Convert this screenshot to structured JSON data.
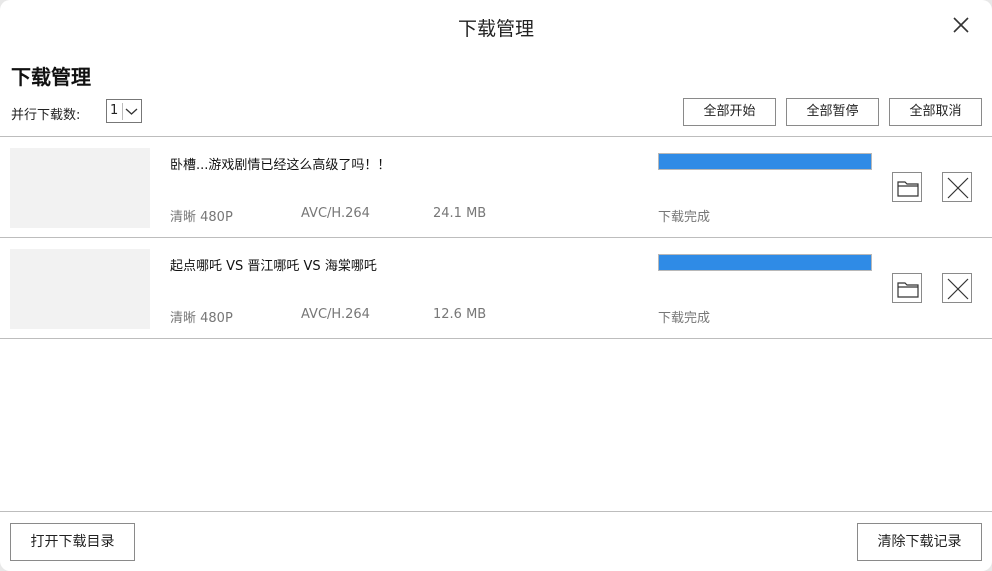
{
  "window": {
    "title": "下载管理"
  },
  "heading": "下载管理",
  "toolbar": {
    "parallel_label": "并行下载数:",
    "parallel_value": "1",
    "start_all": "全部开始",
    "pause_all": "全部暂停",
    "cancel_all": "全部取消"
  },
  "downloads": [
    {
      "title": "卧槽...游戏剧情已经这么高级了吗！！",
      "quality": "清晰 480P",
      "codec": "AVC/H.264",
      "size": "24.1 MB",
      "progress": 1.0,
      "status": "下载完成"
    },
    {
      "title": "起点哪吒 VS 晋江哪吒 VS 海棠哪吒",
      "quality": "清晰 480P",
      "codec": "AVC/H.264",
      "size": "12.6 MB",
      "progress": 1.0,
      "status": "下载完成"
    }
  ],
  "footer": {
    "open_dir": "打开下载目录",
    "clear_records": "清除下载记录"
  },
  "colors": {
    "progress": "#2f8be6"
  },
  "icons": {
    "close": "close-icon",
    "folder": "folder-icon",
    "delete": "x-icon",
    "dropdown": "chevron-down-icon"
  }
}
